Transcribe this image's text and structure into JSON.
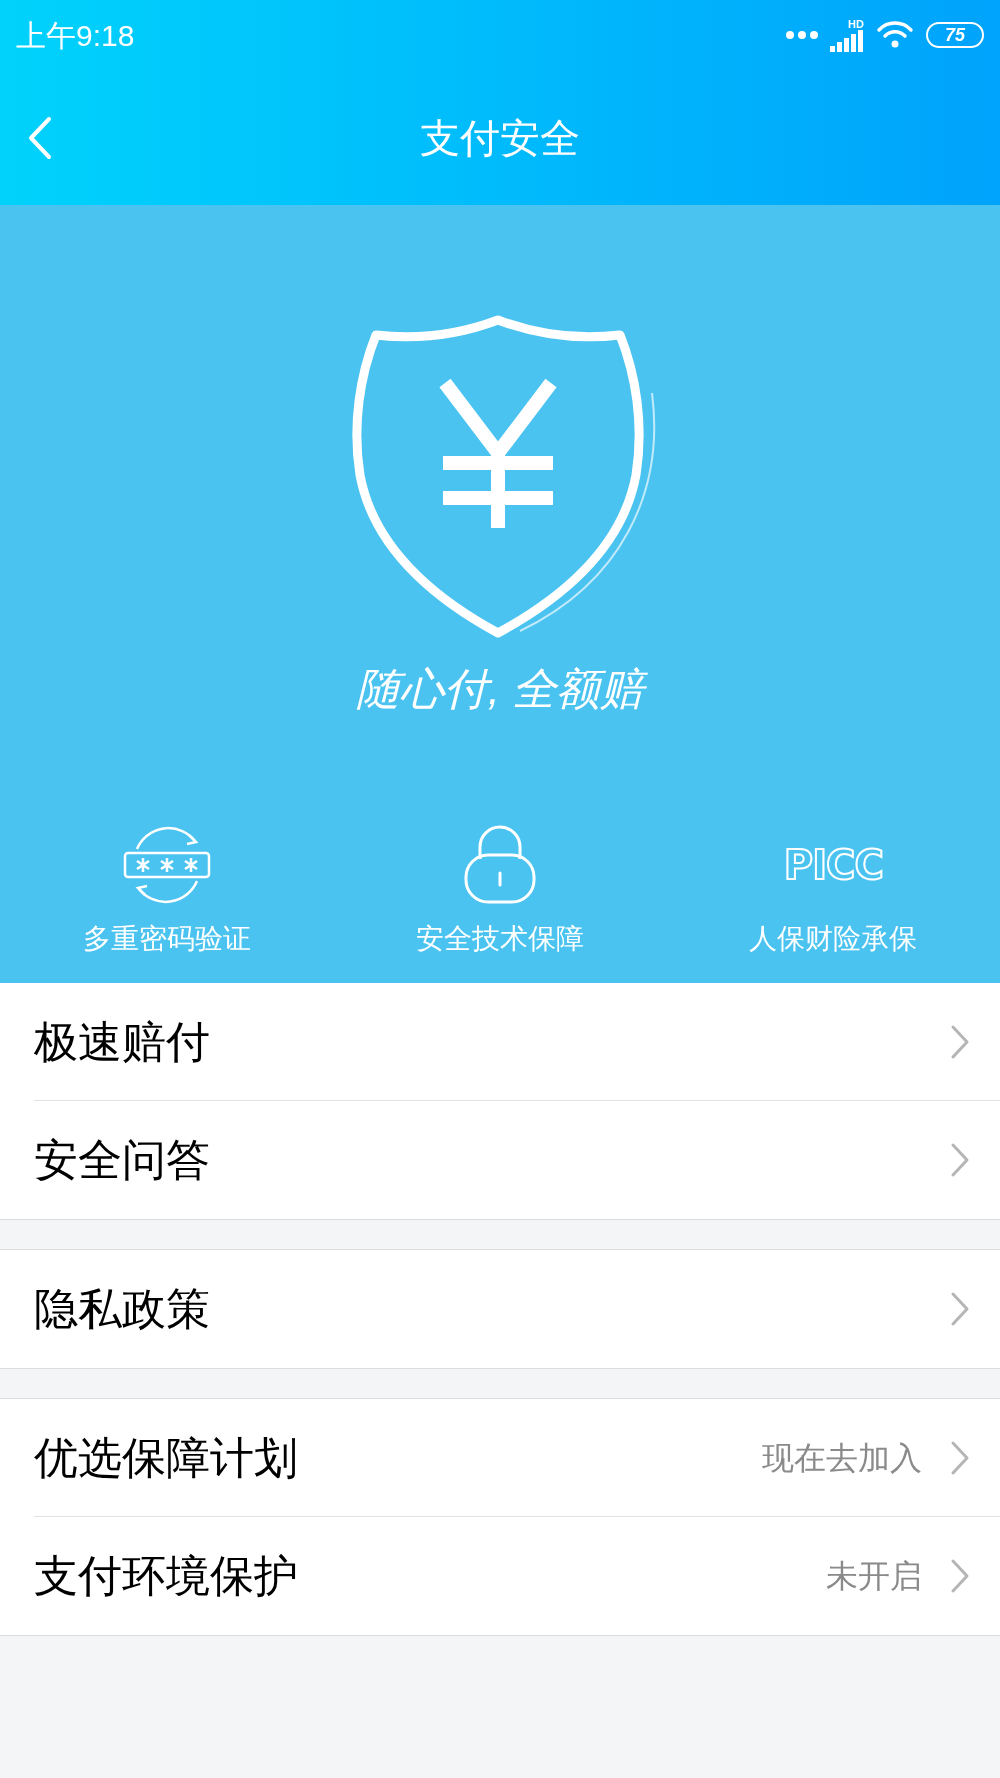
{
  "status_bar": {
    "time": "上午9:18",
    "network_label": "HD",
    "battery": "75"
  },
  "header": {
    "title": "支付安全"
  },
  "hero": {
    "slogan": "随心付, 全额赔",
    "features": [
      {
        "kind": "password",
        "label": "多重密码验证"
      },
      {
        "kind": "lock",
        "label": "安全技术保障"
      },
      {
        "kind": "logo",
        "logo": "PICC",
        "label": "人保财险承保"
      }
    ]
  },
  "sections": [
    [
      {
        "label": "极速赔付"
      },
      {
        "label": "安全问答"
      }
    ],
    [
      {
        "label": "隐私政策"
      }
    ],
    [
      {
        "label": "优选保障计划",
        "value": "现在去加入"
      },
      {
        "label": "支付环境保护",
        "value": "未开启"
      }
    ]
  ]
}
